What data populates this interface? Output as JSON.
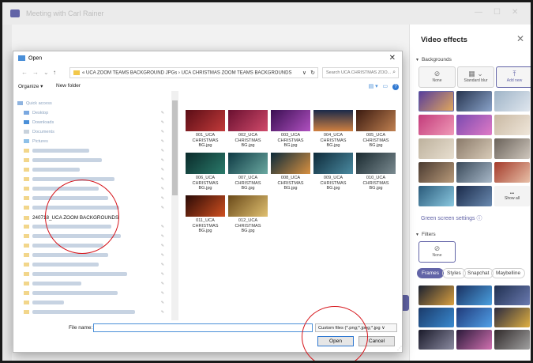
{
  "window": {
    "title": "Meeting with Carl Rainer"
  },
  "dialog": {
    "title": "Open",
    "breadcrumb": "« UCA ZOOM TEAMS BACKGROUND JPGs › UCA CHRISTMAS ZOOM TEAMS BACKGROUNDS",
    "search_placeholder": "Search UCA CHRISTMAS ZOO...",
    "organize_label": "Organize ▾",
    "new_folder_label": "New folder",
    "tree": {
      "quick_access": "Quick access",
      "desktop": "Desktop",
      "downloads": "Downloads",
      "documents": "Documents",
      "pictures": "Pictures",
      "highlighted_folder": "240718_UCA ZOOM BACKGROUNDS"
    },
    "files": [
      {
        "name": "001_UCA CHRISTMAS BG.jpg",
        "color": "#7a1520"
      },
      {
        "name": "002_UCA CHRISTMAS BG.jpg",
        "color": "#8a1d3b"
      },
      {
        "name": "003_UCA CHRISTMAS BG.jpg",
        "color": "#5b1d6e"
      },
      {
        "name": "004_UCA CHRISTMAS BG.jpg",
        "color": "#2a3556"
      },
      {
        "name": "005_UCA CHRISTMAS BG.jpg",
        "color": "#4a2a20"
      },
      {
        "name": "006_UCA CHRISTMAS BG.jpg",
        "color": "#0e3b3a"
      },
      {
        "name": "007_UCA CHRISTMAS BG.jpg",
        "color": "#1e4d57"
      },
      {
        "name": "008_UCA CHRISTMAS BG.jpg",
        "color": "#163a4a"
      },
      {
        "name": "009_UCA CHRISTMAS BG.jpg",
        "color": "#1b3a48"
      },
      {
        "name": "010_UCA CHRISTMAS BG.jpg",
        "color": "#2a3a40"
      },
      {
        "name": "011_UCA CHRISTMAS BG.jpg",
        "color": "#3a1a12"
      },
      {
        "name": "012_UCA CHRISTMAS BG.jpg",
        "color": "#8a6a2a"
      }
    ],
    "file_name_label": "File name:",
    "file_name_value": "",
    "file_type": "Custom files (*.png;*.jpeg;*.jpg ∨",
    "open_label": "Open",
    "cancel_label": "Cancel"
  },
  "video_effects": {
    "title": "Video effects",
    "backgrounds_label": "Backgrounds",
    "none_label": "None",
    "blur_label": "Standard blur",
    "add_new_label": "Add new",
    "show_all_label": "Show all",
    "green_screen_label": "Green screen settings",
    "filters_label": "Filters",
    "filter_none_label": "None",
    "filter_tabs": [
      "Frames",
      "Styles",
      "Snapchat",
      "Maybelline"
    ],
    "active_filter_tab": "Frames"
  },
  "colors": {
    "accent": "#6264a7",
    "annotation": "#d6151b",
    "selection": "#2f78d1"
  }
}
